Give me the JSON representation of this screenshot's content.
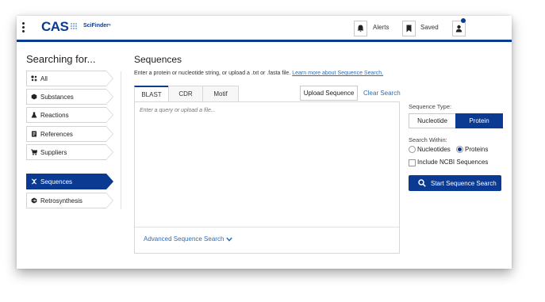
{
  "header": {
    "brand": "CAS",
    "product": "SciFinderⁿ",
    "alerts_label": "Alerts",
    "saved_label": "Saved"
  },
  "sidebar": {
    "title": "Searching for...",
    "items": [
      {
        "label": "All",
        "icon": "all-icon"
      },
      {
        "label": "Substances",
        "icon": "substance-icon"
      },
      {
        "label": "Reactions",
        "icon": "flask-icon"
      },
      {
        "label": "References",
        "icon": "document-icon"
      },
      {
        "label": "Suppliers",
        "icon": "cart-icon"
      },
      {
        "label": "Sequences",
        "icon": "dna-icon",
        "active": true
      },
      {
        "label": "Retrosynthesis",
        "icon": "retrosynthesis-icon"
      }
    ]
  },
  "main": {
    "title": "Sequences",
    "description": "Enter a protein or nucleotide string, or upload a .txt or .fasta file.",
    "learn_more": "Learn more about Sequence Search.",
    "tabs": [
      {
        "label": "BLAST",
        "active": true
      },
      {
        "label": "CDR"
      },
      {
        "label": "Motif"
      }
    ],
    "upload_label": "Upload Sequence",
    "clear_label": "Clear Search",
    "query_placeholder": "Enter a query or upload a file...",
    "advanced_label": "Advanced Sequence Search"
  },
  "options": {
    "sequence_type_label": "Sequence Type:",
    "sequence_types": [
      "Nucleotide",
      "Protein"
    ],
    "sequence_type_selected": "Protein",
    "search_within_label": "Search Within:",
    "search_within": [
      "Nucleotides",
      "Proteins"
    ],
    "search_within_selected": "Proteins",
    "include_ncbi_label": "Include NCBI Sequences",
    "include_ncbi_checked": false,
    "start_label": "Start Sequence Search"
  },
  "colors": {
    "brand_blue": "#0b3a93",
    "link_blue": "#2f6db5"
  }
}
